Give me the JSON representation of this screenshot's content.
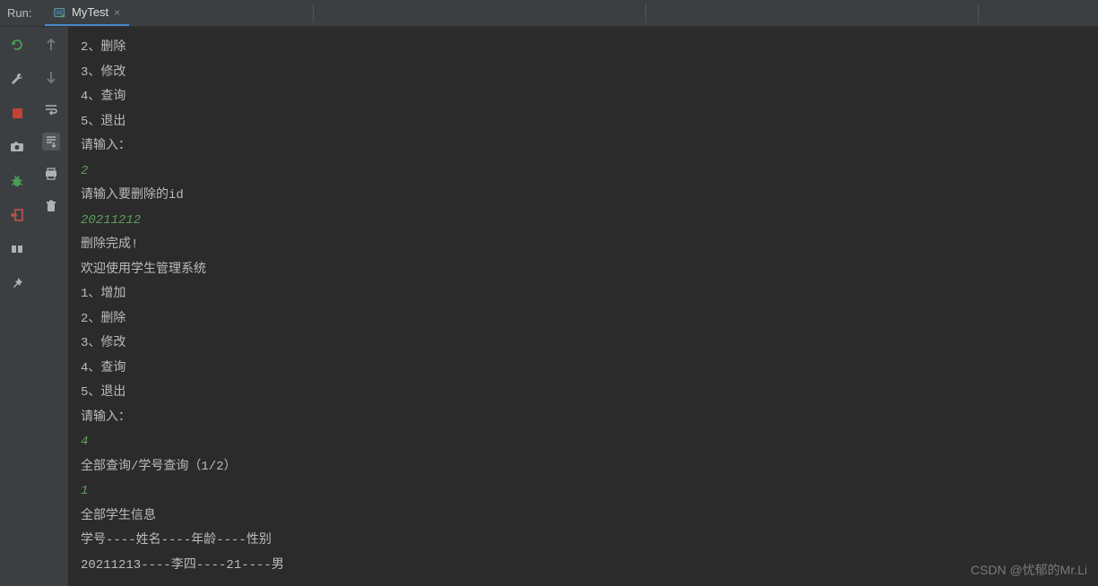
{
  "header": {
    "label": "Run:",
    "tab": {
      "title": "MyTest"
    }
  },
  "console": {
    "lines": [
      {
        "text": "2、删除",
        "type": "normal"
      },
      {
        "text": "3、修改",
        "type": "normal"
      },
      {
        "text": "4、查询",
        "type": "normal"
      },
      {
        "text": "5、退出",
        "type": "normal"
      },
      {
        "text": "请输入：",
        "type": "normal"
      },
      {
        "text": "2",
        "type": "input"
      },
      {
        "text": "请输入要删除的id",
        "type": "normal"
      },
      {
        "text": "20211212",
        "type": "input"
      },
      {
        "text": "删除完成!",
        "type": "normal"
      },
      {
        "text": "欢迎使用学生管理系统",
        "type": "normal"
      },
      {
        "text": "1、增加",
        "type": "normal"
      },
      {
        "text": "2、删除",
        "type": "normal"
      },
      {
        "text": "3、修改",
        "type": "normal"
      },
      {
        "text": "4、查询",
        "type": "normal"
      },
      {
        "text": "5、退出",
        "type": "normal"
      },
      {
        "text": "请输入：",
        "type": "normal"
      },
      {
        "text": "4",
        "type": "input"
      },
      {
        "text": "全部查询/学号查询（1/2）",
        "type": "normal"
      },
      {
        "text": "1",
        "type": "input"
      },
      {
        "text": "全部学生信息",
        "type": "normal"
      },
      {
        "text": "学号----姓名----年龄----性别",
        "type": "normal"
      },
      {
        "text": "20211213----李四----21----男",
        "type": "normal"
      }
    ]
  },
  "watermark": "CSDN @忧郁的Mr.Li"
}
